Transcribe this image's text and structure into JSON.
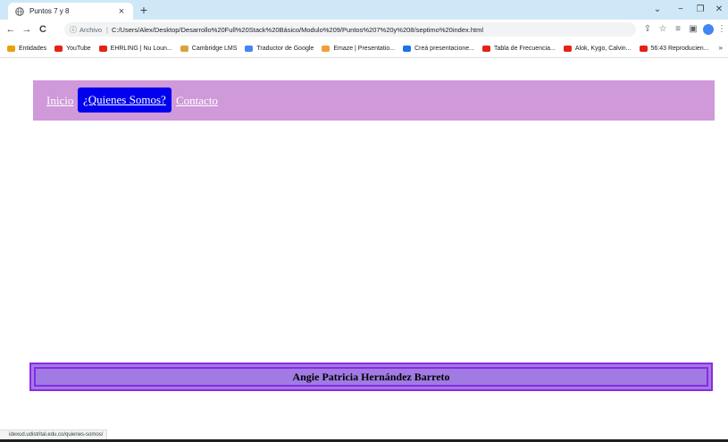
{
  "browser": {
    "tab": {
      "title": "Puntos 7 y 8",
      "favicon": "globe-icon",
      "close": "×"
    },
    "new_tab": "+",
    "window_controls": {
      "chevron": "⌄",
      "minimize": "−",
      "restore": "❐",
      "close": "✕"
    },
    "nav": {
      "back": "←",
      "forward": "→",
      "reload": "C"
    },
    "address": {
      "info": "ⓘ",
      "scheme_label": "Archivo",
      "separator": "|",
      "url": "C:/Users/Alex/Desktop/Desarrollo%20Full%20Stack%20Básico/Modulo%209/Puntos%207%20y%208/septimo%20index.html"
    },
    "toolbar_icons": {
      "share": "⇪",
      "star": "☆",
      "reading_list": "≡",
      "sidebar": "▣",
      "menu": "⋮"
    },
    "bookmarks": [
      {
        "label": "Entidades",
        "color": "#e8a10d"
      },
      {
        "label": "YouTube",
        "color": "#e62117"
      },
      {
        "label": "EHRLING | Nu Loun...",
        "color": "#e62117"
      },
      {
        "label": "Cambridge LMS",
        "color": "#d9a23a"
      },
      {
        "label": "Traductor de Google",
        "color": "#4285f4"
      },
      {
        "label": "Emaze | Presentatio...",
        "color": "#f29d38"
      },
      {
        "label": "Creá presentacione...",
        "color": "#1a73e8"
      },
      {
        "label": "Tabla de Frecuencia...",
        "color": "#e62117"
      },
      {
        "label": "Alok, Kygo, Calvin...",
        "color": "#e62117"
      },
      {
        "label": "56:43 Reproducien...",
        "color": "#e62117"
      }
    ],
    "bookmarks_more": "»",
    "status_text": "idexud.udistrital.edu.co/quienes-somos/"
  },
  "page": {
    "menu": {
      "inicio": "Inicio",
      "quienes": "¿Quienes Somos?",
      "contacto": "Contacto"
    },
    "footer": {
      "name": "Angie Patricia Hernández Barreto"
    }
  }
}
